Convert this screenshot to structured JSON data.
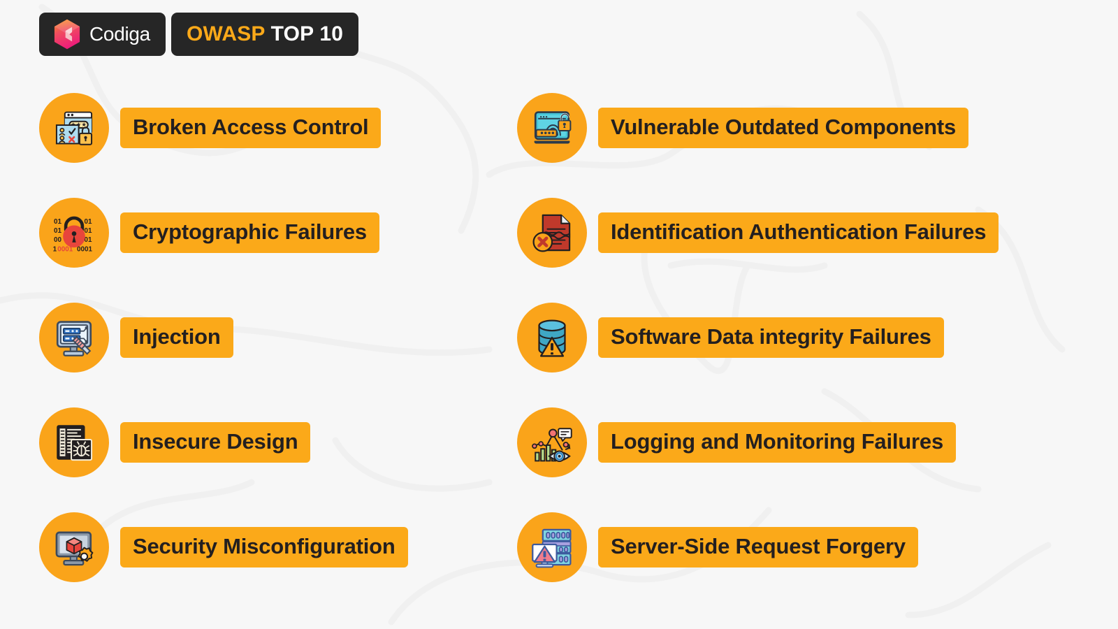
{
  "header": {
    "logo_icon": "codiga-cube-logo",
    "logo_text": "Codiga",
    "title_highlight": "OWASP",
    "title_rest": " TOP 10",
    "title_full": "OWASP TOP 10"
  },
  "colors": {
    "background": "#f7f7f7",
    "watermark_stroke": "#f0f0f0",
    "header_box": "#262626",
    "accent_orange": "#FBA919",
    "circle_orange": "#FAA41A",
    "label_text": "#231f20",
    "logo_gradient_start": "#F7931E",
    "logo_gradient_end": "#ED1E79"
  },
  "left_column": [
    {
      "label": "Broken Access Control",
      "icon": "browser-password-user-lock-icon"
    },
    {
      "label": "Cryptographic Failures",
      "icon": "red-padlock-binary-icon"
    },
    {
      "label": "Injection",
      "icon": "monitor-server-syringe-icon"
    },
    {
      "label": "Insecure Design",
      "icon": "code-document-bug-icon"
    },
    {
      "label": "Security Misconfiguration",
      "icon": "monitor-cube-gear-icon"
    }
  ],
  "right_column": [
    {
      "label": "Vulnerable Outdated Components",
      "icon": "laptop-fingerprint-open-lock-icon"
    },
    {
      "label": "Identification Authentication Failures",
      "icon": "document-x-mark-icon"
    },
    {
      "label": "Software Data integrity Failures",
      "icon": "database-warning-icon"
    },
    {
      "label": "Logging and Monitoring Failures",
      "icon": "chart-eye-monitoring-icon"
    },
    {
      "label": "Server-Side Request Forgery",
      "icon": "server-monitor-warning-icon"
    }
  ]
}
